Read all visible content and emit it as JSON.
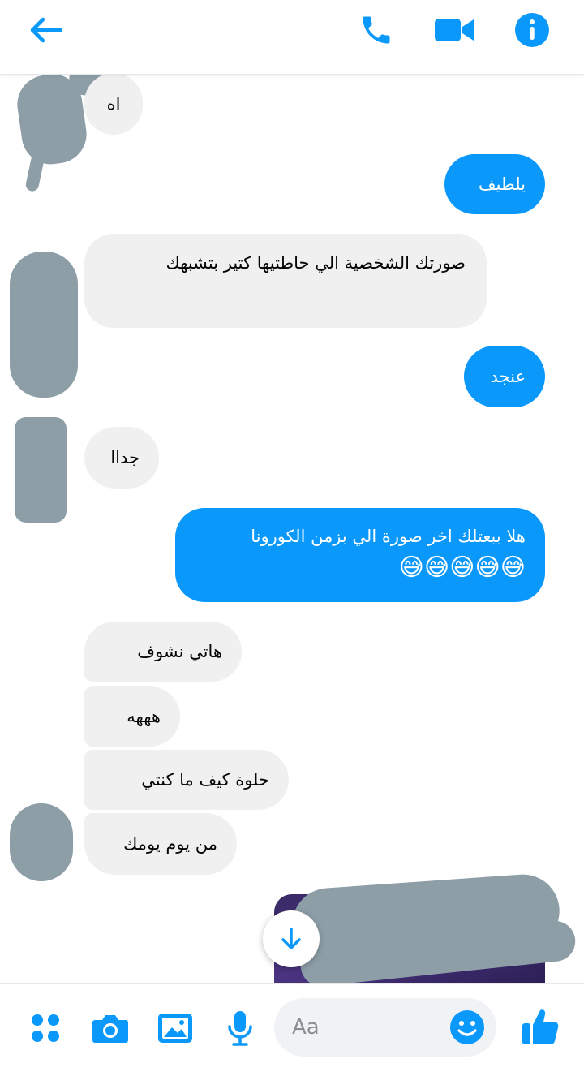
{
  "header": {
    "contact_name": "",
    "accent_color": "#0a98fb"
  },
  "messages": {
    "m1": "اه",
    "m2": "يلطيف",
    "m3": "صورتك الشخصية الي حاطتيها كتير بتشبهك",
    "m4": "عنجد",
    "m5": "جداا",
    "m6_text": "هلا ببعتلك اخر صورة الي بزمن الكورونا",
    "m6_emoji": "😅😅😅😅😅",
    "g1": "هاتي نشوف",
    "g2": "هههه",
    "g3": "حلوة كيف ما كنتي",
    "g4": "من يوم يومك"
  },
  "composer": {
    "placeholder": "Aa"
  },
  "colors": {
    "incoming_bubble": "#f0f0f0",
    "outgoing_bubble": "#0a98fb",
    "redaction": "#8d9ea7"
  },
  "icons": [
    "back-arrow-icon",
    "phone-icon",
    "video-icon",
    "info-icon",
    "arrow-down-icon",
    "apps-icon",
    "camera-icon",
    "gallery-icon",
    "microphone-icon",
    "emoji-icon",
    "thumbs-up-icon"
  ]
}
